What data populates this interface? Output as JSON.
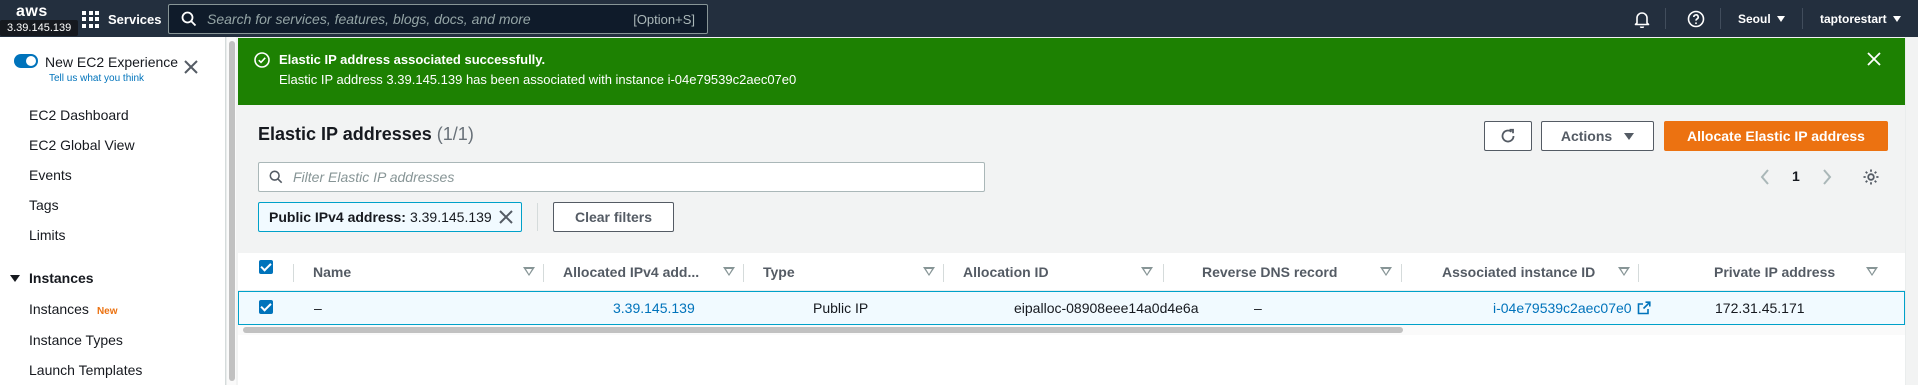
{
  "topnav": {
    "logo": "aws",
    "ip_tooltip": "3.39.145.139",
    "services": "Services",
    "search_placeholder": "Search for services, features, blogs, docs, and more",
    "search_shortcut": "[Option+S]",
    "region": "Seoul",
    "account": "taptorestart"
  },
  "sidebar": {
    "new_experience": "New EC2 Experience",
    "tell_us": "Tell us what you think",
    "items": [
      {
        "label": "EC2 Dashboard"
      },
      {
        "label": "EC2 Global View"
      },
      {
        "label": "Events"
      },
      {
        "label": "Tags"
      },
      {
        "label": "Limits"
      }
    ],
    "section": "Instances",
    "section_items": [
      {
        "label": "Instances",
        "badge": "New"
      },
      {
        "label": "Instance Types"
      },
      {
        "label": "Launch Templates"
      }
    ]
  },
  "flash": {
    "title": "Elastic IP address associated successfully.",
    "message": "Elastic IP address 3.39.145.139 has been associated with instance i-04e79539c2aec07e0",
    "color": "#1d8102"
  },
  "page": {
    "title": "Elastic IP addresses",
    "count": "(1/1)",
    "actions_label": "Actions",
    "allocate_label": "Allocate Elastic IP address",
    "filter_placeholder": "Filter Elastic IP addresses",
    "page_number": "1",
    "token_key": "Public IPv4 address:",
    "token_value": "3.39.145.139",
    "clear_filters": "Clear filters",
    "accent": "#ec7211"
  },
  "table": {
    "columns": [
      "Name",
      "Allocated IPv4 add...",
      "Type",
      "Allocation ID",
      "Reverse DNS record",
      "Associated instance ID",
      "Private IP address"
    ],
    "rows": [
      {
        "name": "–",
        "ipv4": "3.39.145.139",
        "type": "Public IP",
        "allocation_id": "eipalloc-08908eee14a0d4e6a",
        "reverse_dns": "–",
        "instance_id": "i-04e79539c2aec07e0",
        "private_ip": "172.31.45.171"
      }
    ]
  }
}
